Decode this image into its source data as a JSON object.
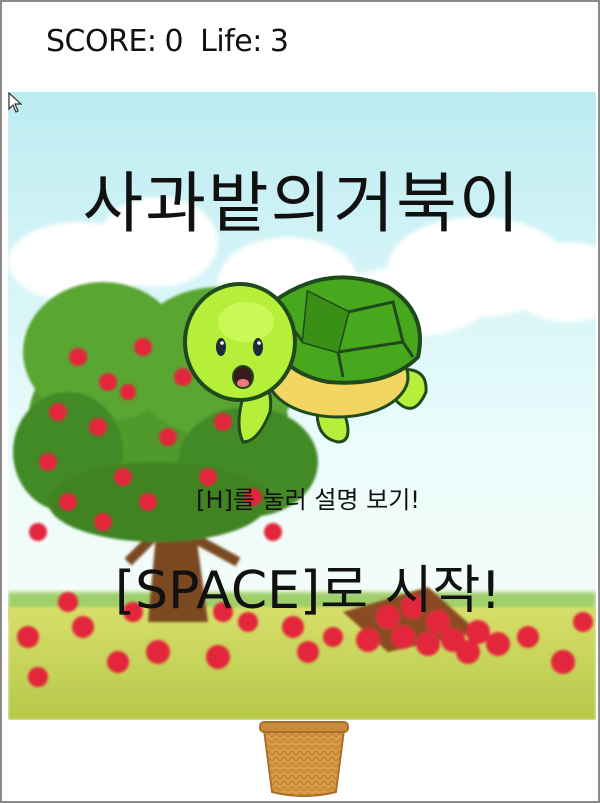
{
  "hud": {
    "score_label": "SCORE:",
    "score_value": "0",
    "life_label": "Life:",
    "life_value": "3"
  },
  "game": {
    "title": "사과밭의거북이",
    "help_hint": "[H]를 눌러 설명 보기!",
    "start_hint": "[SPACE]로 시작!"
  },
  "colors": {
    "sky_top": "#bfeef2",
    "sky_bottom": "#e8fbfb",
    "grass": "#c9d657",
    "apple": "#e3283a",
    "tree_leaves": "#4f9a2c",
    "turtle_shell": "#47a81e",
    "turtle_skin": "#b6ef3a",
    "basket": "#d89a45"
  },
  "icons": [
    "turtle-character",
    "apple-tree",
    "apple-basket",
    "mouse-cursor-icon",
    "basket-player"
  ]
}
